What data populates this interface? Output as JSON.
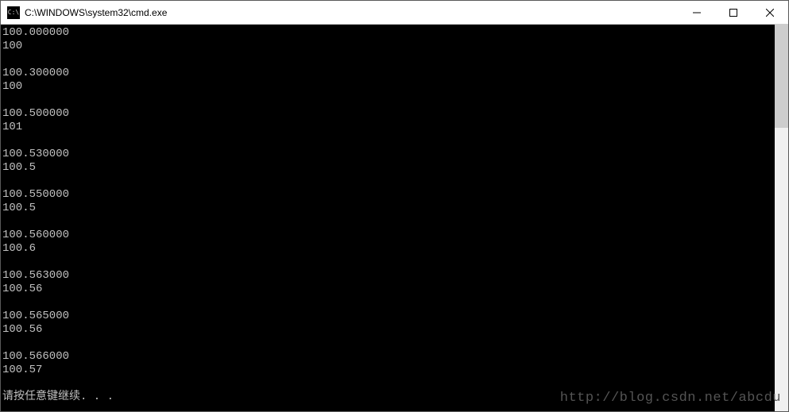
{
  "window": {
    "icon_label": "C:\\",
    "title": "C:\\WINDOWS\\system32\\cmd.exe"
  },
  "terminal": {
    "lines": [
      "100.000000",
      "100",
      "",
      "100.300000",
      "100",
      "",
      "100.500000",
      "101",
      "",
      "100.530000",
      "100.5",
      "",
      "100.550000",
      "100.5",
      "",
      "100.560000",
      "100.6",
      "",
      "100.563000",
      "100.56",
      "",
      "100.565000",
      "100.56",
      "",
      "100.566000",
      "100.57",
      "",
      "请按任意键继续. . ."
    ]
  },
  "watermark": "http://blog.csdn.net/abcdu"
}
